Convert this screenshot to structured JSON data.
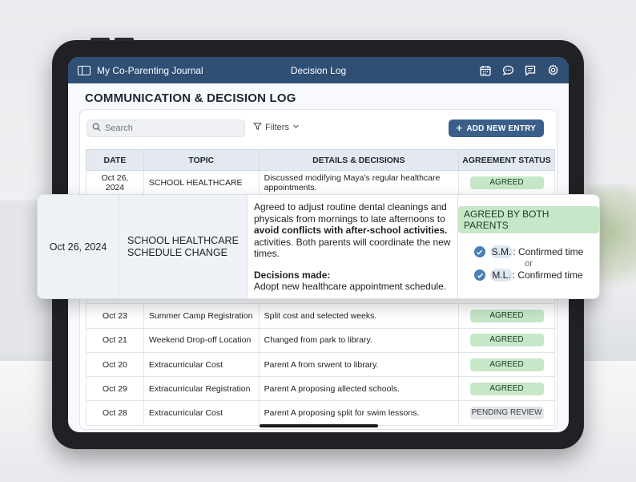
{
  "app": {
    "title": "My Co-Parenting Journal",
    "section": "Decision Log",
    "accent": "#2f4f75",
    "icons": [
      "sidebar-icon",
      "calendar-icon",
      "chat-icon",
      "message-icon",
      "gear-icon"
    ]
  },
  "page": {
    "title": "COMMUNICATION & DECISION LOG"
  },
  "toolbar": {
    "search_placeholder": "Search",
    "filters_label": "Filters",
    "add_label": "ADD NEW ENTRY"
  },
  "table": {
    "headers": [
      "DATE",
      "TOPIC",
      "DETAILS & DECISIONS",
      "AGREEMENT STATUS"
    ],
    "first_row": {
      "date": "Oct 26, 2024",
      "topic": "SCHOOL HEALTHCARE",
      "details": "Discussed modifying Maya's regular healthcare appointments.",
      "status": "AGREED"
    },
    "rows": [
      {
        "date": "Oct 23",
        "topic": "Summer Camp Registration",
        "details": "Split cost and selected weeks.",
        "status": "AGREED"
      },
      {
        "date": "Oct 21",
        "topic": "Weekend Drop-off Location",
        "details": "Changed from park to library.",
        "status": "AGREED"
      },
      {
        "date": "Oct 20",
        "topic": "Extracurricular Cost",
        "details": "Parent A from srwent to library.",
        "status": "AGREED"
      },
      {
        "date": "Oct 29",
        "topic": "Extracurricular Registration",
        "details": "Parent A proposing allected schools.",
        "status": "AGREED"
      },
      {
        "date": "Oct 28",
        "topic": "Extracurricular Cost",
        "details": "Parent A proposing split for swim lessons.",
        "status": "PENDING REVIEW"
      }
    ]
  },
  "zoom": {
    "date": "Oct 26, 2024",
    "topic_line1": "SCHOOL HEALTHCARE",
    "topic_line2": "SCHEDULE CHANGE",
    "details_lead": "Agreed to adjust routine dental cleanings and physicals from mornings to late afternoons to",
    "details_bold": "avoid conflicts with after-school activities.",
    "details_tail": "activities. Both parents will coordinate the new times.",
    "decisions_label": "Decisions made:",
    "decisions_text": "Adopt new healthcare appointment schedule.",
    "status": "AGREED BY BOTH PARENTS",
    "confirm1_initials": "S.M.",
    "confirm1_text": ": Confirmed time",
    "or_label": "or",
    "confirm2_initials": "M.L.",
    "confirm2_text": ": Confirmed time"
  },
  "colors": {
    "agreed_bg": "#c7e7c9",
    "pending_bg": "#e3e5e8",
    "button": "#3a5f8a"
  }
}
